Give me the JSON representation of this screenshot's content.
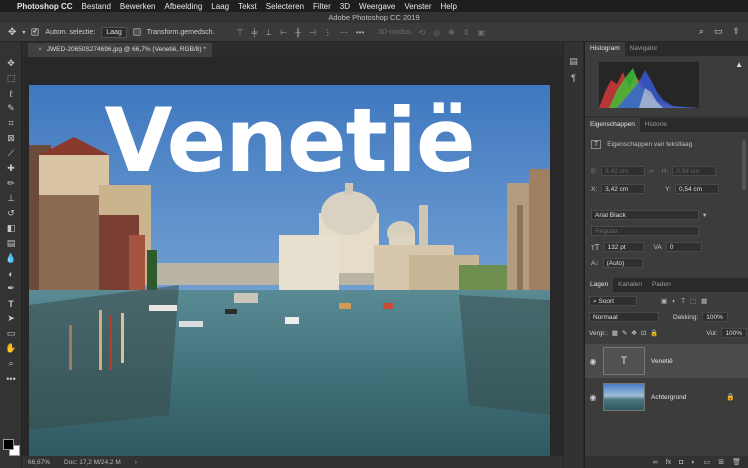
{
  "menubar": {
    "app": "Photoshop CC",
    "items": [
      "Bestand",
      "Bewerken",
      "Afbeelding",
      "Laag",
      "Tekst",
      "Selecteren",
      "Filter",
      "3D",
      "Weergave",
      "Venster",
      "Help"
    ]
  },
  "window": {
    "title": "Adobe Photoshop CC 2019"
  },
  "options": {
    "auto_select_label": "Autom. selectie:",
    "auto_select_value": "Laag",
    "transform_label": "Transform.gemedsch.",
    "mode_3d_label": "3D-modus:"
  },
  "document": {
    "tab_label": "JWED-20650S274696.jpg @ 66,7% (Venetië, RGB/8) *",
    "headline": "Venetië"
  },
  "status": {
    "zoom": "66,67%",
    "doc": "Doc: 17,2 M/24,2 M"
  },
  "histogram_panel": {
    "tabs": [
      "Histogram",
      "Navigator"
    ]
  },
  "properties_panel": {
    "tabs": [
      "Eigenschappen",
      "Historie"
    ],
    "subtitle": "Eigenschappen van tekstlaag",
    "w_value": "3,42 cm",
    "h_value": "0,54 cm",
    "x_label": "X:",
    "x_value": "3,42 cm",
    "y_label": "Y:",
    "y_value": "0,54 cm",
    "font_family": "Arial Black",
    "font_style": "Regular",
    "font_size": "132 pt",
    "tracking": "0",
    "leading": "(Auto)"
  },
  "layers_panel": {
    "tabs": [
      "Lagen",
      "Kanalen",
      "Paden"
    ],
    "filter": "Soort",
    "blend_mode": "Normaal",
    "opacity_label": "Dekking:",
    "opacity_value": "100%",
    "lock_label": "Vergr.:",
    "fill_label": "Vul:",
    "fill_value": "100%",
    "layers": [
      {
        "name": "Venetië",
        "type": "text",
        "selected": true
      },
      {
        "name": "Achtergrond",
        "type": "image",
        "selected": false
      }
    ]
  }
}
